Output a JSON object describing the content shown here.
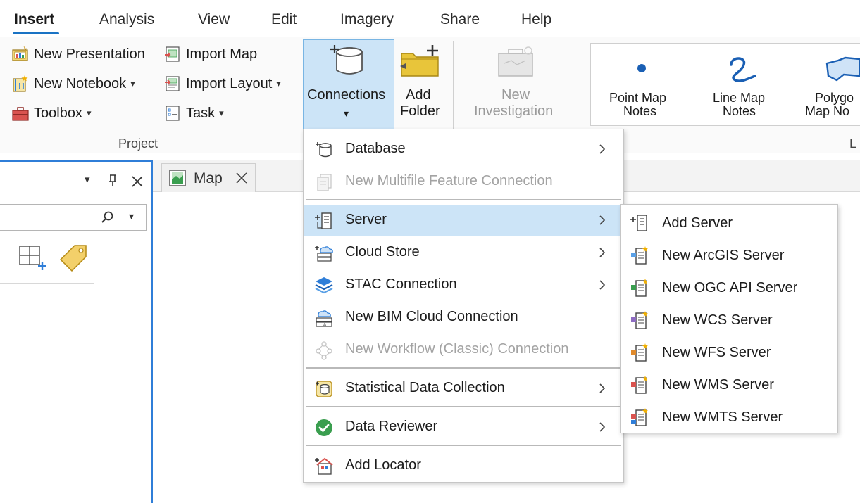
{
  "tabs": [
    {
      "label": "Insert",
      "active": true
    },
    {
      "label": "Analysis"
    },
    {
      "label": "View"
    },
    {
      "label": "Edit"
    },
    {
      "label": "Imagery"
    },
    {
      "label": "Share"
    },
    {
      "label": "Help"
    }
  ],
  "ribbon": {
    "project": {
      "new_presentation": "New Presentation",
      "new_notebook": "New Notebook",
      "toolbox": "Toolbox",
      "import_map": "Import Map",
      "import_layout": "Import Layout",
      "task": "Task",
      "group_label": "Project"
    },
    "connections_label": "Connections",
    "add_folder_line1": "Add",
    "add_folder_line2": "Folder",
    "new_investigation_line1": "New",
    "new_investigation_line2": "Investigation",
    "notes": {
      "point_line1": "Point Map",
      "point_line2": "Notes",
      "line_line1": "Line Map",
      "line_line2": "Notes",
      "polygon_line1": "Polygo",
      "polygon_line2": "Map No",
      "group_label": "L"
    }
  },
  "map_tab": {
    "label": "Map"
  },
  "menu": {
    "items": [
      {
        "label": "Database",
        "icon": "database-icon",
        "submenu": true
      },
      {
        "label": "New Multifile Feature Connection",
        "icon": "multifile-icon",
        "disabled": true
      },
      {
        "label": "Server",
        "icon": "server-icon",
        "submenu": true,
        "highlighted": true
      },
      {
        "label": "Cloud Store",
        "icon": "cloud-store-icon",
        "submenu": true
      },
      {
        "label": "STAC Connection",
        "icon": "stac-icon",
        "submenu": true
      },
      {
        "label": "New BIM Cloud Connection",
        "icon": "bim-cloud-icon"
      },
      {
        "label": "New Workflow (Classic) Connection",
        "icon": "workflow-icon",
        "disabled": true
      },
      {
        "label": "Statistical Data Collection",
        "icon": "statistical-data-icon",
        "submenu": true
      },
      {
        "label": "Data Reviewer",
        "icon": "data-reviewer-icon",
        "submenu": true
      },
      {
        "label": "Add Locator",
        "icon": "locator-icon"
      }
    ]
  },
  "submenu": {
    "items": [
      {
        "label": "Add Server",
        "icon": "add-server-icon"
      },
      {
        "label": "New ArcGIS Server",
        "icon": "arcgis-server-icon"
      },
      {
        "label": "New OGC API Server",
        "icon": "ogc-server-icon"
      },
      {
        "label": "New WCS Server",
        "icon": "wcs-server-icon"
      },
      {
        "label": "New WFS Server",
        "icon": "wfs-server-icon"
      },
      {
        "label": "New WMS Server",
        "icon": "wms-server-icon"
      },
      {
        "label": "New WMTS Server",
        "icon": "wmts-server-icon"
      }
    ]
  },
  "colors": {
    "accent": "#1a73c4",
    "highlight": "#cce4f7",
    "highlight_border": "#79b5e3",
    "folder_yellow": "#e8c53a",
    "reviewer_green": "#3a9e4f"
  }
}
